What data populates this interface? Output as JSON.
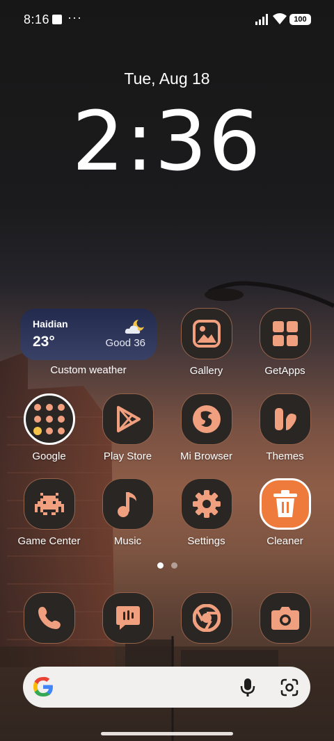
{
  "status_bar": {
    "time": "8:16",
    "battery": "100"
  },
  "lockscreen": {
    "date": "Tue, Aug 18",
    "clock": "2:36"
  },
  "weather_widget": {
    "city": "Haidian",
    "temperature": "23°",
    "air_quality": "Good 36",
    "label": "Custom weather",
    "icon": "partly-cloudy-night-icon"
  },
  "apps": {
    "gallery": "Gallery",
    "getapps": "GetApps",
    "google": "Google",
    "play_store": "Play Store",
    "mi_browser": "Mi Browser",
    "themes": "Themes",
    "game_center": "Game Center",
    "music": "Music",
    "settings": "Settings",
    "cleaner": "Cleaner"
  },
  "dock": [
    "phone-icon",
    "messaging-icon",
    "chrome-icon",
    "camera-icon"
  ],
  "page_indicator": {
    "pages": 2,
    "current": 1
  },
  "colors": {
    "icon_accent": "#f0a07e",
    "icon_bg": "#2a2623",
    "cleaner_bg": "#ee7a3c"
  }
}
